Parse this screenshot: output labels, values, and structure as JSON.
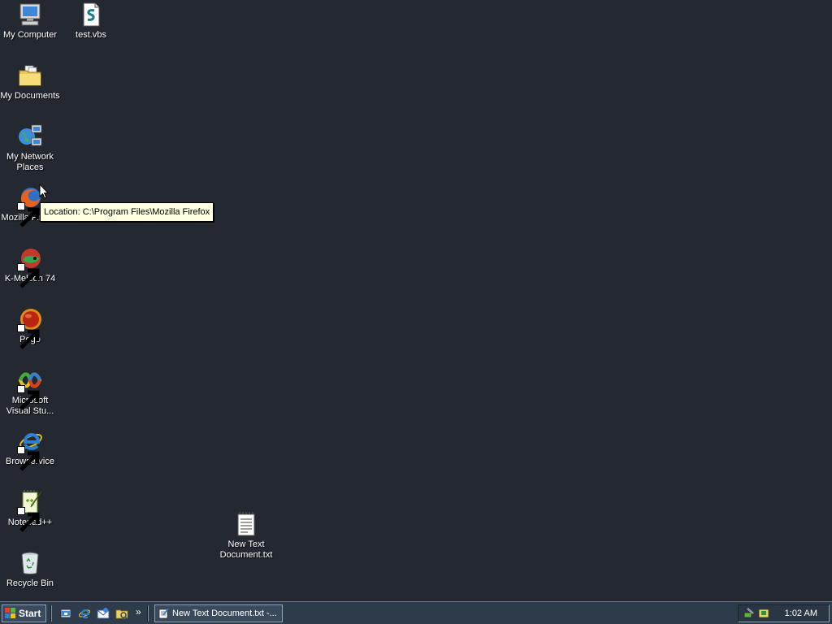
{
  "desktop": {
    "icons": [
      {
        "id": "my-computer",
        "label": "My Computer",
        "icon": "computer-icon"
      },
      {
        "id": "test-vbs",
        "label": "test.vbs",
        "icon": "script-file-icon"
      },
      {
        "id": "my-documents",
        "label": "My Documents",
        "icon": "folder-icon"
      },
      {
        "id": "my-network-places",
        "label": "My Network Places",
        "icon": "network-icon"
      },
      {
        "id": "mozilla-firefox",
        "label": "Mozilla Firefox",
        "icon": "firefox-icon"
      },
      {
        "id": "k-meleon",
        "label": "K-Meleon 74",
        "icon": "k-meleon-icon"
      },
      {
        "id": "pego",
        "label": "Pego",
        "icon": "pego-icon"
      },
      {
        "id": "visual-studio",
        "label": "Microsoft Visual Stu...",
        "icon": "visual-studio-icon"
      },
      {
        "id": "browservice",
        "label": "Browservice",
        "icon": "internet-explorer-icon"
      },
      {
        "id": "notepad-plus-plus",
        "label": "Notepad++",
        "icon": "notepad-plus-plus-icon"
      },
      {
        "id": "recycle-bin",
        "label": "Recycle Bin",
        "icon": "recycle-bin-icon"
      },
      {
        "id": "new-text-document",
        "label": "New Text Document.txt",
        "icon": "text-file-icon"
      }
    ],
    "tooltip": "Location: C:\\Program Files\\Mozilla Firefox"
  },
  "taskbar": {
    "start_label": "Start",
    "quick_launch_chevron": "»",
    "task_button_label": "New Text Document.txt -...",
    "clock": "1:02 AM"
  },
  "colors": {
    "desktop_background": "#232831",
    "taskbar_background": "#2e3b4a",
    "tooltip_background": "#ffffe1"
  }
}
